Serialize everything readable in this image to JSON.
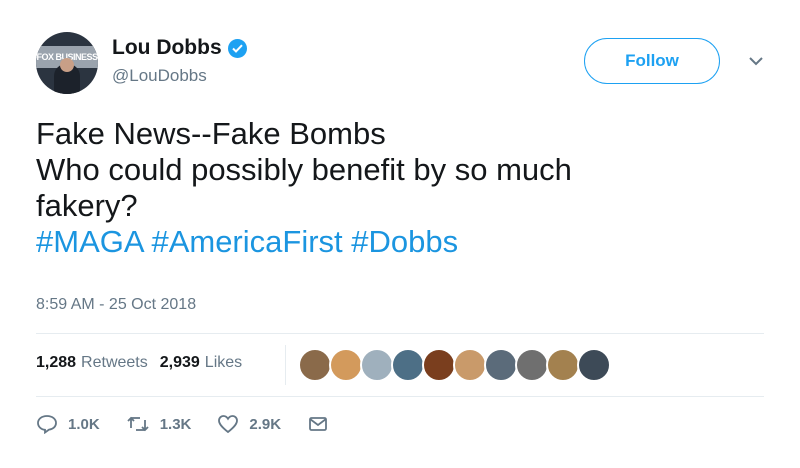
{
  "author": {
    "display_name": "Lou Dobbs",
    "handle": "@LouDobbs",
    "avatar_text": "FOX BUSINESS"
  },
  "follow_label": "Follow",
  "tweet": {
    "lines": [
      "Fake News--Fake Bombs",
      "Who could possibly benefit by so much",
      "fakery?"
    ],
    "hashtags": [
      "#MAGA",
      "#AmericaFirst",
      "#Dobbs"
    ],
    "timestamp": "8:59 AM - 25 Oct 2018"
  },
  "stats": {
    "retweets_count": "1,288",
    "retweets_label": "Retweets",
    "likes_count": "2,939",
    "likes_label": "Likes"
  },
  "liker_avatars": [
    {
      "name": "avatar-1",
      "color": "#8a6a4a"
    },
    {
      "name": "avatar-2",
      "color": "#d39a5c"
    },
    {
      "name": "avatar-3",
      "color": "#9fb0bd"
    },
    {
      "name": "avatar-4",
      "color": "#4d6f86"
    },
    {
      "name": "avatar-5",
      "color": "#7a3e1e"
    },
    {
      "name": "avatar-6",
      "color": "#c99a6a"
    },
    {
      "name": "avatar-7",
      "color": "#5b6b7a"
    },
    {
      "name": "avatar-8",
      "color": "#6f6f6f"
    },
    {
      "name": "avatar-9",
      "color": "#a3814f"
    },
    {
      "name": "avatar-10",
      "color": "#3d4a57"
    }
  ],
  "actions": {
    "replies": "1.0K",
    "retweets": "1.3K",
    "likes": "2.9K"
  },
  "colors": {
    "accent": "#1da1f2",
    "hashtag": "#1b95e0",
    "muted": "#657786",
    "text": "#14171a",
    "divider": "#e6ecf0"
  }
}
